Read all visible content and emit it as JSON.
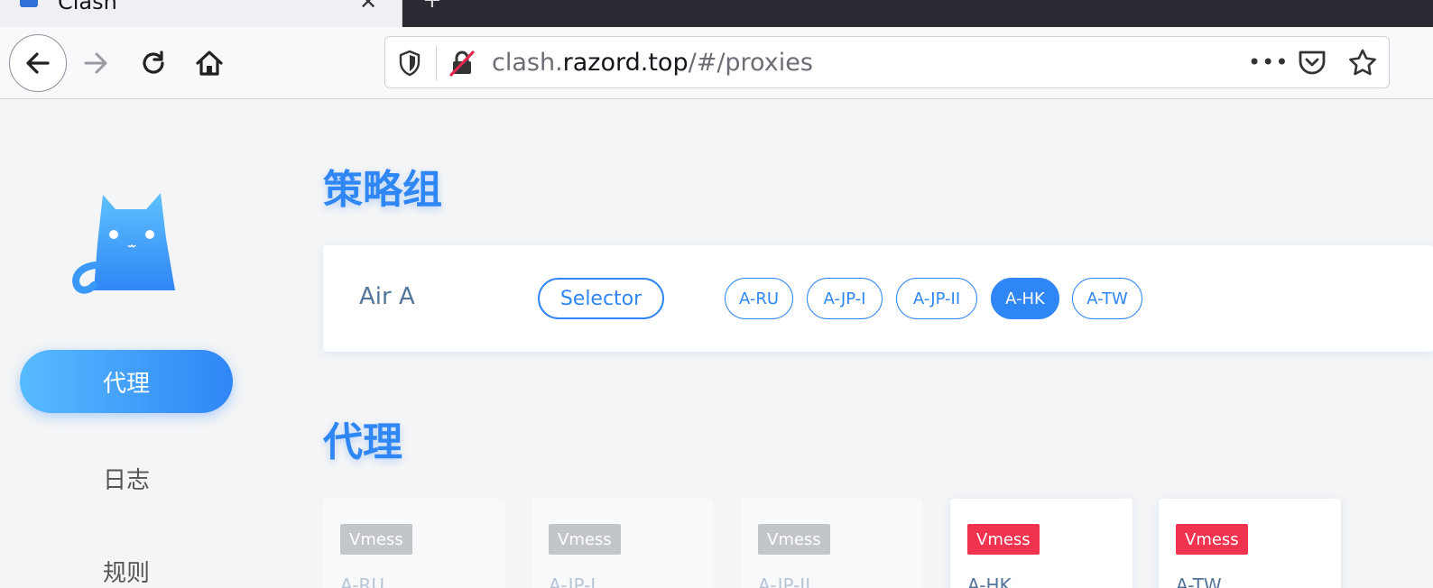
{
  "browser": {
    "tab_title": "Clash",
    "url_prefix": "clash.",
    "url_domain": "razord.top",
    "url_path": "/#/proxies",
    "more_label": "•••"
  },
  "sidebar": {
    "items": [
      {
        "label": "代理",
        "active": true
      },
      {
        "label": "日志",
        "active": false
      },
      {
        "label": "规则",
        "active": false
      }
    ]
  },
  "groups_section": {
    "title": "策略组",
    "group": {
      "name": "Air A",
      "type": "Selector",
      "options": [
        "A-RU",
        "A-JP-I",
        "A-JP-II",
        "A-HK",
        "A-TW"
      ],
      "selected": "A-HK"
    }
  },
  "proxies_section": {
    "title": "代理",
    "cards": [
      {
        "type": "Vmess",
        "name": "A-RU"
      },
      {
        "type": "Vmess",
        "name": "A-JP-I"
      },
      {
        "type": "Vmess",
        "name": "A-JP-II"
      },
      {
        "type": "Vmess",
        "name": "A-HK"
      },
      {
        "type": "Vmess",
        "name": "A-TW"
      }
    ]
  },
  "colors": {
    "accent": "#2f86f5",
    "tag_red": "#f2334f",
    "tag_gray": "#c2c5ca"
  }
}
